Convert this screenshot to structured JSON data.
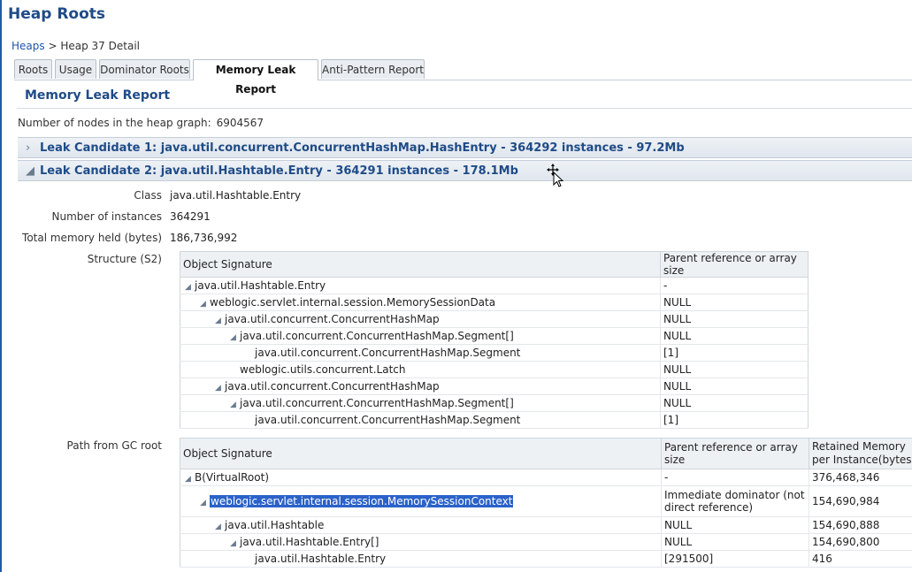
{
  "page_title": "Heap Roots",
  "breadcrumb": {
    "link": "Heaps",
    "separator": ">",
    "current": "Heap 37 Detail"
  },
  "tabs": [
    {
      "label": "Roots"
    },
    {
      "label": "Usage"
    },
    {
      "label": "Dominator Roots"
    },
    {
      "label": "Memory Leak Report"
    },
    {
      "label": "Anti-Pattern Report"
    }
  ],
  "section_title": "Memory Leak Report",
  "nodes": {
    "label": "Number of nodes in the heap graph:",
    "value": "6904567"
  },
  "candidates": [
    {
      "label": "Leak Candidate 1: java.util.concurrent.ConcurrentHashMap.HashEntry - 364292 instances - 97.2Mb",
      "expanded": false
    },
    {
      "label": "Leak Candidate 2: java.util.Hashtable.Entry - 364291 instances - 178.1Mb",
      "expanded": true
    }
  ],
  "details": {
    "class_label": "Class",
    "class_value": "java.util.Hashtable.Entry",
    "instances_label": "Number of instances",
    "instances_value": "364291",
    "memory_label": "Total memory held (bytes)",
    "memory_value": "186,736,992",
    "structure_label": "Structure (S2)",
    "path_label": "Path from GC root"
  },
  "structure_table": {
    "headers": [
      "Object Signature",
      "Parent reference or array size"
    ],
    "rows": [
      {
        "sig": "java.util.Hashtable.Entry",
        "ref": "-",
        "expand": true
      },
      {
        "sig": "weblogic.servlet.internal.session.MemorySessionData",
        "ref": "NULL",
        "expand": true
      },
      {
        "sig": "java.util.concurrent.ConcurrentHashMap",
        "ref": "NULL",
        "expand": true
      },
      {
        "sig": "java.util.concurrent.ConcurrentHashMap.Segment[]",
        "ref": "NULL",
        "expand": true
      },
      {
        "sig": "java.util.concurrent.ConcurrentHashMap.Segment",
        "ref": "[1]",
        "expand": false
      },
      {
        "sig": "weblogic.utils.concurrent.Latch",
        "ref": "NULL",
        "expand": false
      },
      {
        "sig": "java.util.concurrent.ConcurrentHashMap",
        "ref": "NULL",
        "expand": true
      },
      {
        "sig": "java.util.concurrent.ConcurrentHashMap.Segment[]",
        "ref": "NULL",
        "expand": true
      },
      {
        "sig": "java.util.concurrent.ConcurrentHashMap.Segment",
        "ref": "[1]",
        "expand": false
      }
    ]
  },
  "path_table": {
    "headers": [
      "Object Signature",
      "Parent reference or array size",
      "Retained Memory per Instance(bytes)"
    ],
    "rows": [
      {
        "sig": "B(VirtualRoot)",
        "ref": "-",
        "mem": "376,468,346",
        "expand": true
      },
      {
        "sig": "weblogic.servlet.internal.session.MemorySessionContext",
        "ref": "Immediate dominator (not direct reference)",
        "mem": "154,690,984",
        "expand": true,
        "selected": true
      },
      {
        "sig": "java.util.Hashtable",
        "ref": "NULL",
        "mem": "154,690,888",
        "expand": true
      },
      {
        "sig": "java.util.Hashtable.Entry[]",
        "ref": "NULL",
        "mem": "154,690,800",
        "expand": true
      },
      {
        "sig": "java.util.Hashtable.Entry",
        "ref": "[291500]",
        "mem": "416",
        "expand": false
      }
    ]
  },
  "colors": {
    "title": "#1f4b87",
    "link": "#1c56a6",
    "selection": "#2a62c9"
  }
}
